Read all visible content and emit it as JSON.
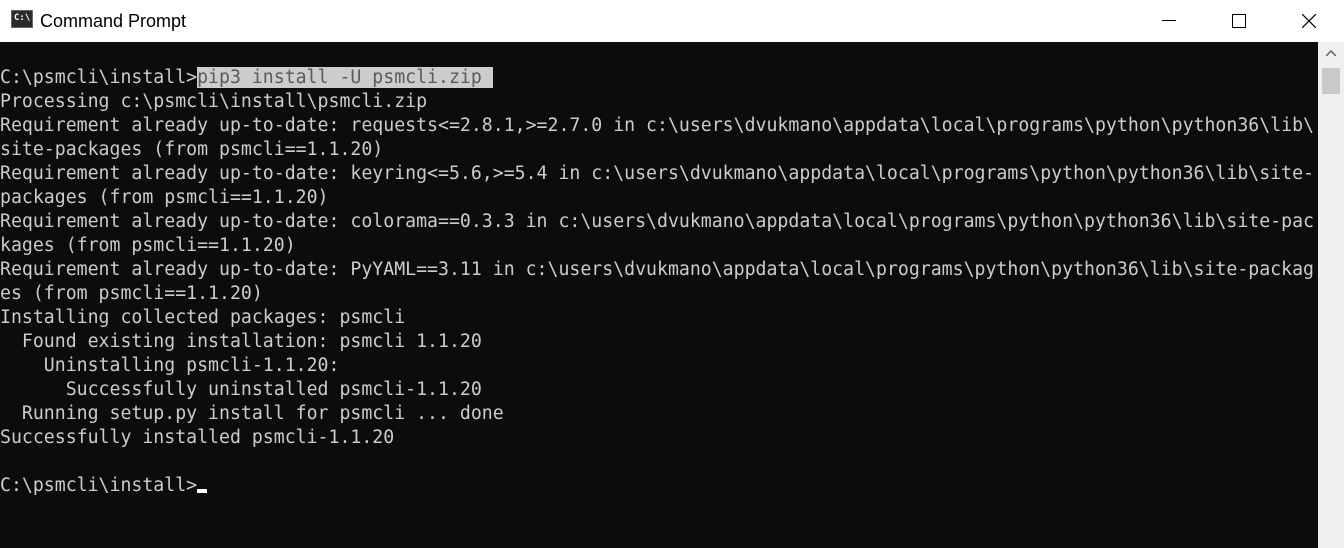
{
  "window": {
    "title": "Command Prompt",
    "icon": "cmd-icon",
    "icon_text": "C:\\",
    "controls": [
      "minimize-icon",
      "maximize-icon",
      "close-icon"
    ]
  },
  "console": {
    "prompt": "C:\\psmcli\\install>",
    "command": "pip3 install -U psmcli.zip ",
    "output": [
      "Processing c:\\psmcli\\install\\psmcli.zip",
      "Requirement already up-to-date: requests<=2.8.1,>=2.7.0 in c:\\users\\dvukmano\\appdata\\local\\programs\\python\\python36\\lib\\",
      "site-packages (from psmcli==1.1.20)",
      "Requirement already up-to-date: keyring<=5.6,>=5.4 in c:\\users\\dvukmano\\appdata\\local\\programs\\python\\python36\\lib\\site-",
      "packages (from psmcli==1.1.20)",
      "Requirement already up-to-date: colorama==0.3.3 in c:\\users\\dvukmano\\appdata\\local\\programs\\python\\python36\\lib\\site-pac",
      "kages (from psmcli==1.1.20)",
      "Requirement already up-to-date: PyYAML==3.11 in c:\\users\\dvukmano\\appdata\\local\\programs\\python\\python36\\lib\\site-packag",
      "es (from psmcli==1.1.20)",
      "Installing collected packages: psmcli",
      "  Found existing installation: psmcli 1.1.20",
      "    Uninstalling psmcli-1.1.20:",
      "      Successfully uninstalled psmcli-1.1.20",
      "  Running setup.py install for psmcli ... done",
      "Successfully installed psmcli-1.1.20"
    ],
    "final_prompt": "C:\\psmcli\\install>"
  },
  "colors": {
    "background": "#0c0c0c",
    "text": "#cccccc",
    "selection": "#cccccc"
  }
}
